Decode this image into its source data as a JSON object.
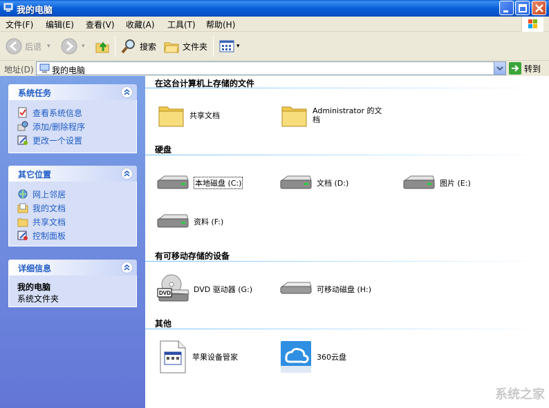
{
  "window": {
    "title": "我的电脑"
  },
  "menu": [
    "文件(F)",
    "编辑(E)",
    "查看(V)",
    "收藏(A)",
    "工具(T)",
    "帮助(H)"
  ],
  "toolbar": {
    "back": "后退",
    "search": "搜索",
    "folders": "文件夹"
  },
  "address": {
    "label": "地址(D)",
    "value": "我的电脑",
    "go": "转到"
  },
  "sidebar": {
    "system_tasks": {
      "title": "系统任务",
      "items": [
        "查看系统信息",
        "添加/删除程序",
        "更改一个设置"
      ]
    },
    "other_places": {
      "title": "其它位置",
      "items": [
        "网上邻居",
        "我的文档",
        "共享文档",
        "控制面板"
      ]
    },
    "details": {
      "title": "详细信息",
      "name": "我的电脑",
      "desc": "系统文件夹"
    }
  },
  "groups": {
    "stored": {
      "title": "在这台计算机上存储的文件",
      "items": [
        "共享文档",
        "Administrator 的文档"
      ]
    },
    "hdd": {
      "title": "硬盘",
      "items": [
        "本地磁盘 (C:)",
        "文档 (D:)",
        "图片 (E:)",
        "资料 (F:)"
      ]
    },
    "removable": {
      "title": "有可移动存储的设备",
      "items": [
        "DVD 驱动器 (G:)",
        "可移动磁盘 (H:)"
      ]
    },
    "other": {
      "title": "其他",
      "items": [
        "苹果设备管家",
        "360云盘"
      ]
    }
  },
  "watermark": "系统之家",
  "colors": {
    "titlebar": "#0a5fd8",
    "sidebar": "#6f8ddf",
    "link": "#215dc6"
  }
}
